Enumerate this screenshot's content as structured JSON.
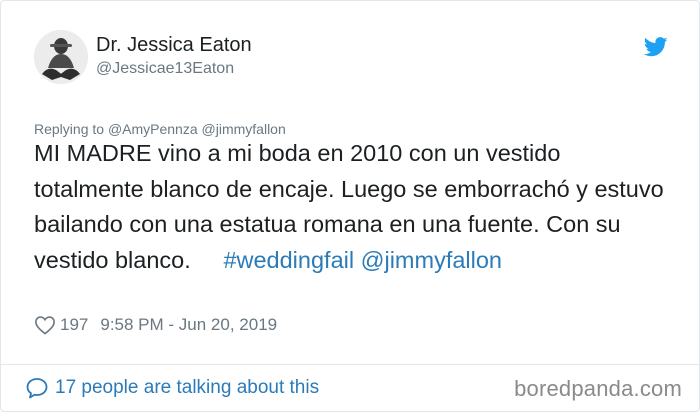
{
  "author": {
    "display_name": "Dr. Jessica Eaton",
    "handle": "@Jessicae13Eaton"
  },
  "reply": {
    "prefix": "Replying to",
    "mentions": [
      "@AmyPennza",
      "@jimmyfallon"
    ]
  },
  "tweet": {
    "text_part1": "MI MADRE vino a mi boda en 2010 con un vestido totalmente blanco de encaje. Luego se emborrachó y estuvo bailando con una estatua romana en una fuente. Con su vestido blanco.",
    "hashtag": "#weddingfail",
    "mention": "@jimmyfallon"
  },
  "meta": {
    "likes": "197",
    "timestamp": "9:58 PM - Jun 20, 2019"
  },
  "footer": {
    "talking_text": "17 people are talking about this",
    "watermark": "boredpanda.com"
  },
  "icons": {
    "brand": "twitter-bird-icon",
    "like": "heart-outline-icon",
    "comment": "speech-bubble-icon"
  },
  "colors": {
    "link": "#2b7bb9",
    "muted": "#697882",
    "text": "#1c2022",
    "twitter_blue": "#1da1f2"
  }
}
